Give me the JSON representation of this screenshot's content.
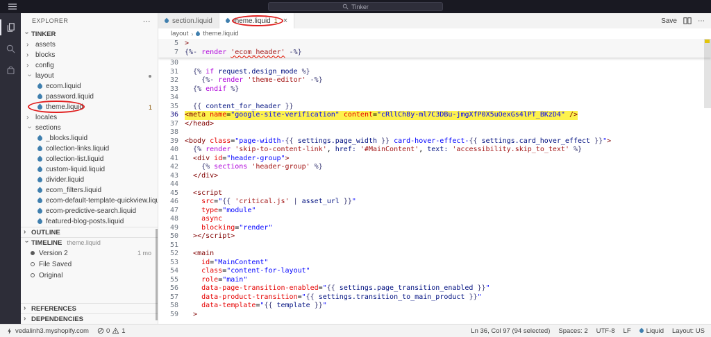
{
  "title_bar": {
    "search_label": "Tinker"
  },
  "activity_bar": {
    "items": [
      {
        "name": "explorer",
        "active": true
      },
      {
        "name": "search",
        "active": false
      },
      {
        "name": "extension",
        "active": false
      }
    ]
  },
  "sidebar": {
    "header": "EXPLORER",
    "section_label": "TINKER",
    "tree": [
      {
        "label": "assets",
        "type": "folder",
        "expanded": false
      },
      {
        "label": "blocks",
        "type": "folder",
        "expanded": false
      },
      {
        "label": "config",
        "type": "folder",
        "expanded": false
      },
      {
        "label": "layout",
        "type": "folder",
        "expanded": true,
        "dot": true
      },
      {
        "label": "ecom.liquid",
        "type": "file"
      },
      {
        "label": "password.liquid",
        "type": "file"
      },
      {
        "label": "theme.liquid",
        "type": "file",
        "badge": "1"
      },
      {
        "label": "locales",
        "type": "folder",
        "expanded": false
      },
      {
        "label": "sections",
        "type": "folder",
        "expanded": true
      },
      {
        "label": "_blocks.liquid",
        "type": "file"
      },
      {
        "label": "collection-links.liquid",
        "type": "file"
      },
      {
        "label": "collection-list.liquid",
        "type": "file"
      },
      {
        "label": "custom-liquid.liquid",
        "type": "file"
      },
      {
        "label": "divider.liquid",
        "type": "file"
      },
      {
        "label": "ecom_filters.liquid",
        "type": "file"
      },
      {
        "label": "ecom-default-template-quickview.liquid",
        "type": "file"
      },
      {
        "label": "ecom-predictive-search.liquid",
        "type": "file"
      },
      {
        "label": "featured-blog-posts.liquid",
        "type": "file"
      }
    ],
    "outline_header": "OUTLINE",
    "timeline_header": "TIMELINE",
    "timeline_desc": "theme.liquid",
    "timeline_items": [
      {
        "label": "Version 2",
        "meta": "1 mo",
        "filled": true
      },
      {
        "label": "File Saved",
        "filled": false
      },
      {
        "label": "Original",
        "filled": false
      }
    ],
    "references_header": "REFERENCES",
    "dependencies_header": "DEPENDENCIES"
  },
  "editor": {
    "tabs": [
      {
        "label": "section.liquid",
        "active": false
      },
      {
        "label": "theme.liquid",
        "active": true,
        "badge": "1",
        "close": "×"
      }
    ],
    "save_label": "Save",
    "more_label": "⋯",
    "breadcrumb": {
      "folder": "layout",
      "file": "theme.liquid"
    },
    "sticky_lines": [
      {
        "n": 5,
        "ind": 0,
        "seg": [
          [
            ">",
            "t"
          ]
        ]
      },
      {
        "n": 7,
        "ind": 0,
        "seg": [
          [
            "{%- ",
            "d"
          ],
          [
            "render",
            "k"
          ],
          [
            " ",
            "p"
          ],
          [
            "'ecom_header'",
            "s",
            "sq"
          ],
          [
            " -%}",
            "d"
          ]
        ]
      }
    ],
    "lines": [
      {
        "n": 30,
        "ind": 0,
        "seg": []
      },
      {
        "n": 31,
        "ind": 2,
        "seg": [
          [
            "{% ",
            "d"
          ],
          [
            "if",
            "k"
          ],
          [
            " ",
            "p"
          ],
          [
            "request.design_mode",
            "v"
          ],
          [
            " %}",
            "d"
          ]
        ]
      },
      {
        "n": 32,
        "ind": 4,
        "seg": [
          [
            "{%- ",
            "d"
          ],
          [
            "render",
            "k"
          ],
          [
            " ",
            "p"
          ],
          [
            "'theme-editor'",
            "s"
          ],
          [
            " -%}",
            "d"
          ]
        ]
      },
      {
        "n": 33,
        "ind": 2,
        "seg": [
          [
            "{% ",
            "d"
          ],
          [
            "endif",
            "k"
          ],
          [
            " %}",
            "d"
          ]
        ]
      },
      {
        "n": 34,
        "ind": 0,
        "seg": []
      },
      {
        "n": 35,
        "ind": 2,
        "seg": [
          [
            "{{ ",
            "d"
          ],
          [
            "content_for_header",
            "v"
          ],
          [
            " }}",
            "d"
          ]
        ]
      },
      {
        "n": 36,
        "ind": 0,
        "hl": true,
        "cur": true,
        "seg": [
          [
            "<meta",
            "t"
          ],
          [
            " ",
            "p"
          ],
          [
            "name",
            "a"
          ],
          [
            "=",
            "p"
          ],
          [
            "\"google-site-verification\"",
            "q"
          ],
          [
            " ",
            "p"
          ],
          [
            "content",
            "a"
          ],
          [
            "=",
            "p"
          ],
          [
            "\"cRllCh8y-ml7C3DBu-jmgXfP0X5uOexGs4lPT_BKzD4\"",
            "q"
          ],
          [
            " />",
            "t"
          ]
        ]
      },
      {
        "n": 37,
        "ind": 0,
        "seg": [
          [
            "</",
            "t"
          ],
          [
            "head",
            "t"
          ],
          [
            ">",
            "t"
          ]
        ]
      },
      {
        "n": 38,
        "ind": 0,
        "seg": []
      },
      {
        "n": 39,
        "ind": 0,
        "seg": [
          [
            "<body",
            "t"
          ],
          [
            " ",
            "p"
          ],
          [
            "class",
            "a"
          ],
          [
            "=",
            "p"
          ],
          [
            "\"page-width-",
            "q"
          ],
          [
            "{{ ",
            "d"
          ],
          [
            "settings.page_width",
            "v"
          ],
          [
            " }}",
            "d"
          ],
          [
            " card-hover-effect-",
            "q"
          ],
          [
            "{{ ",
            "d"
          ],
          [
            "settings.card_hover_effect",
            "v"
          ],
          [
            " }}",
            "d"
          ],
          [
            "\"",
            "q"
          ],
          [
            ">",
            "t"
          ]
        ]
      },
      {
        "n": 40,
        "ind": 2,
        "seg": [
          [
            "{% ",
            "d"
          ],
          [
            "render",
            "k"
          ],
          [
            " ",
            "p"
          ],
          [
            "'skip-to-content-link'",
            "s"
          ],
          [
            ", ",
            "p"
          ],
          [
            "href:",
            "v"
          ],
          [
            " ",
            "p"
          ],
          [
            "'#MainContent'",
            "s"
          ],
          [
            ", ",
            "p"
          ],
          [
            "text:",
            "v"
          ],
          [
            " ",
            "p"
          ],
          [
            "'accessibility.skip_to_text'",
            "s"
          ],
          [
            " %}",
            "d"
          ]
        ]
      },
      {
        "n": 41,
        "ind": 2,
        "seg": [
          [
            "<div",
            "t"
          ],
          [
            " ",
            "p"
          ],
          [
            "id",
            "a"
          ],
          [
            "=",
            "p"
          ],
          [
            "\"header-group\"",
            "q"
          ],
          [
            ">",
            "t"
          ]
        ]
      },
      {
        "n": 42,
        "ind": 4,
        "seg": [
          [
            "{% ",
            "d"
          ],
          [
            "sections",
            "k"
          ],
          [
            " ",
            "p"
          ],
          [
            "'header-group'",
            "s"
          ],
          [
            " %}",
            "d"
          ]
        ]
      },
      {
        "n": 43,
        "ind": 2,
        "seg": [
          [
            "</",
            "t"
          ],
          [
            "div",
            "t"
          ],
          [
            ">",
            "t"
          ]
        ]
      },
      {
        "n": 44,
        "ind": 0,
        "seg": []
      },
      {
        "n": 45,
        "ind": 2,
        "seg": [
          [
            "<script",
            "t"
          ]
        ]
      },
      {
        "n": 46,
        "ind": 4,
        "seg": [
          [
            "src",
            "a"
          ],
          [
            "=",
            "p"
          ],
          [
            "\"",
            "q"
          ],
          [
            "{{ ",
            "d"
          ],
          [
            "'critical.js'",
            "s"
          ],
          [
            " | ",
            "d"
          ],
          [
            "asset_url",
            "v"
          ],
          [
            " }}",
            "d"
          ],
          [
            "\"",
            "q"
          ]
        ]
      },
      {
        "n": 47,
        "ind": 4,
        "seg": [
          [
            "type",
            "a"
          ],
          [
            "=",
            "p"
          ],
          [
            "\"module\"",
            "q"
          ]
        ]
      },
      {
        "n": 48,
        "ind": 4,
        "seg": [
          [
            "async",
            "a"
          ]
        ]
      },
      {
        "n": 49,
        "ind": 4,
        "seg": [
          [
            "blocking",
            "a"
          ],
          [
            "=",
            "p"
          ],
          [
            "\"render\"",
            "q"
          ]
        ]
      },
      {
        "n": 50,
        "ind": 2,
        "seg": [
          [
            ">",
            "t"
          ],
          [
            "</",
            "t"
          ],
          [
            "script",
            "t"
          ],
          [
            ">",
            "t"
          ]
        ]
      },
      {
        "n": 51,
        "ind": 0,
        "seg": []
      },
      {
        "n": 52,
        "ind": 2,
        "seg": [
          [
            "<main",
            "t"
          ]
        ]
      },
      {
        "n": 53,
        "ind": 4,
        "seg": [
          [
            "id",
            "a"
          ],
          [
            "=",
            "p"
          ],
          [
            "\"MainContent\"",
            "q"
          ]
        ]
      },
      {
        "n": 54,
        "ind": 4,
        "seg": [
          [
            "class",
            "a"
          ],
          [
            "=",
            "p"
          ],
          [
            "\"content-for-layout\"",
            "q"
          ]
        ]
      },
      {
        "n": 55,
        "ind": 4,
        "seg": [
          [
            "role",
            "a"
          ],
          [
            "=",
            "p"
          ],
          [
            "\"main\"",
            "q"
          ]
        ]
      },
      {
        "n": 56,
        "ind": 4,
        "seg": [
          [
            "data-page-transition-enabled",
            "a"
          ],
          [
            "=",
            "p"
          ],
          [
            "\"",
            "q"
          ],
          [
            "{{ ",
            "d"
          ],
          [
            "settings.page_transition_enabled",
            "v"
          ],
          [
            " }}",
            "d"
          ],
          [
            "\"",
            "q"
          ]
        ]
      },
      {
        "n": 57,
        "ind": 4,
        "seg": [
          [
            "data-product-transition",
            "a"
          ],
          [
            "=",
            "p"
          ],
          [
            "\"",
            "q"
          ],
          [
            "{{ ",
            "d"
          ],
          [
            "settings.transition_to_main_product",
            "v"
          ],
          [
            " }}",
            "d"
          ],
          [
            "\"",
            "q"
          ]
        ]
      },
      {
        "n": 58,
        "ind": 4,
        "seg": [
          [
            "data-template",
            "a"
          ],
          [
            "=",
            "p"
          ],
          [
            "\"",
            "q"
          ],
          [
            "{{ ",
            "d"
          ],
          [
            "template",
            "v"
          ],
          [
            " }}",
            "d"
          ],
          [
            "\"",
            "q"
          ]
        ]
      },
      {
        "n": 59,
        "ind": 2,
        "seg": [
          [
            ">",
            "t"
          ]
        ]
      }
    ]
  },
  "status_bar": {
    "remote": "vedalinh3.myshopify.com",
    "errors": "0",
    "warnings": "1",
    "right_items": [
      {
        "text": "Ln 36, Col 97 (94 selected)"
      },
      {
        "text": "Spaces: 2"
      },
      {
        "text": "UTF-8"
      },
      {
        "text": "LF"
      },
      {
        "text": "Liquid",
        "icon": "liquid"
      },
      {
        "text": "Layout: US"
      }
    ]
  },
  "colors": {
    "highlight_yellow": "#fdf24d",
    "annotation_red": "#e01e1e",
    "warning_badge": "#895503"
  }
}
